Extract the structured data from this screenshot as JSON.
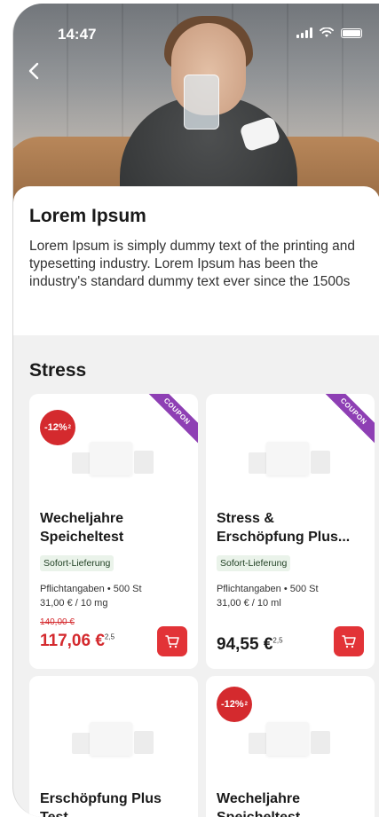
{
  "status_bar": {
    "time": "14:47"
  },
  "intro": {
    "title": "Lorem Ipsum",
    "body": "Lorem Ipsum is simply dummy text of the printing and typesetting industry. Lorem Ipsum has been the industry's standard dummy text ever since the 1500s"
  },
  "section": {
    "title": "Stress"
  },
  "products": [
    {
      "name_line1": "Wecheljahre",
      "name_line2": "Speicheltest",
      "coupon": "COUPON",
      "discount": "-12%",
      "discount_note": "2",
      "delivery": "Sofort-Lieferung",
      "meta_line1": "Pflichtangaben • 500 St",
      "meta_line2": "31,00 € / 10 mg",
      "old_price": "140,00 €",
      "price": "117,06 €",
      "price_note": "2,5"
    },
    {
      "name_line1": "Stress &",
      "name_line2": "Erschöpfung Plus...",
      "coupon": "COUPON",
      "delivery": "Sofort-Lieferung",
      "meta_line1": "Pflichtangaben • 500 St",
      "meta_line2": "31,00 € / 10 ml",
      "price": "94,55 €",
      "price_note": "2,5"
    },
    {
      "name_line1": "Erschöpfung Plus",
      "name_line2": "Test"
    },
    {
      "name_line1": "Wecheljahre",
      "name_line2": "Speicheltest",
      "discount": "-12%",
      "discount_note": "2"
    }
  ],
  "colors": {
    "accent_red": "#e23337",
    "coupon_purple": "#8e3fb4",
    "delivery_bg": "#eaf3ea"
  },
  "icons": {
    "back": "chevron-left-icon",
    "cart": "cart-icon",
    "signal": "signal-icon",
    "wifi": "wifi-icon",
    "battery": "battery-icon"
  }
}
